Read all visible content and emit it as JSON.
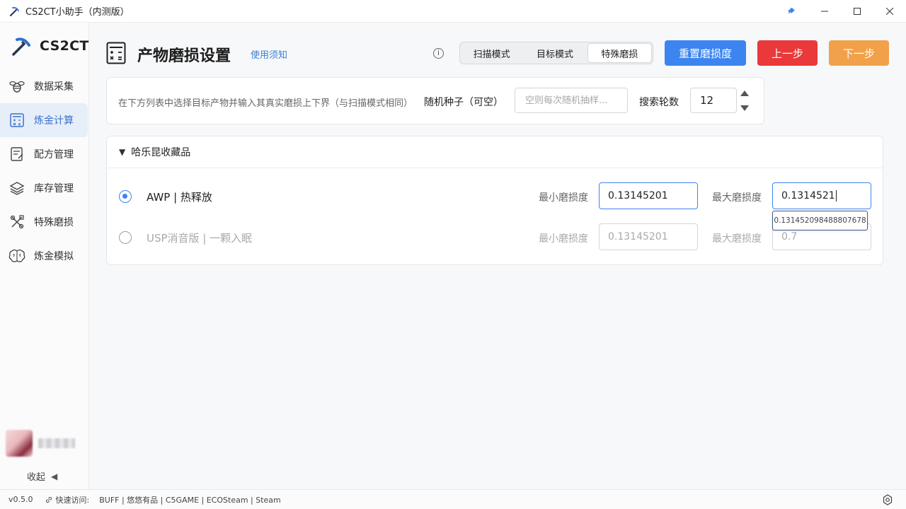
{
  "window": {
    "title": "CS2CT小助手（内测版）",
    "icons": [
      "pickaxe-icon",
      "pin-icon",
      "minimize-icon",
      "maximize-icon",
      "close-icon"
    ]
  },
  "sidebar": {
    "brand": "CS2CT",
    "items": [
      {
        "label": "数据采集",
        "icon": "bee-icon",
        "active": false
      },
      {
        "label": "炼金计算",
        "icon": "calculator-icon",
        "active": true
      },
      {
        "label": "配方管理",
        "icon": "recipe-icon",
        "active": false
      },
      {
        "label": "库存管理",
        "icon": "layers-icon",
        "active": false
      },
      {
        "label": "特殊磨损",
        "icon": "tools-icon",
        "active": false
      },
      {
        "label": "炼金模拟",
        "icon": "brain-icon",
        "active": false
      }
    ],
    "collapse_label": "收起"
  },
  "header": {
    "title": "产物磨损设置",
    "help_link": "使用须知",
    "modes": [
      "扫描模式",
      "目标模式",
      "特殊磨损"
    ],
    "active_mode": "特殊磨损",
    "reset_button": "重置磨损度",
    "prev_button": "上一步",
    "next_button": "下一步"
  },
  "settings": {
    "hint": "在下方列表中选择目标产物并输入其真实磨损上下界（与扫描模式相同）",
    "seed_label": "随机种子（可空）",
    "seed_placeholder": "空则每次随机抽样...",
    "rounds_label": "搜索轮数",
    "rounds_value": "12"
  },
  "collection": {
    "name": "哈乐昆收藏品",
    "min_label": "最小磨损度",
    "max_label": "最大磨损度",
    "items": [
      {
        "name": "AWP | 热释放",
        "selected": true,
        "min": "0.13145201",
        "max": "0.1314521"
      },
      {
        "name": "USP消音版 | 一颗入眠",
        "selected": false,
        "min": "0.13145201",
        "max": "0.7"
      }
    ],
    "suggestion": "0.131452098488807678"
  },
  "statusbar": {
    "version": "v0.5.0",
    "quick_label": "快速访问:",
    "links": "BUFF | 悠悠有品 | C5GAME | ECOSteam | Steam"
  },
  "colors": {
    "accent": "#3c85f0",
    "danger": "#e9393a",
    "warning": "#f2a14b",
    "active_nav_bg": "#e6eef9"
  }
}
